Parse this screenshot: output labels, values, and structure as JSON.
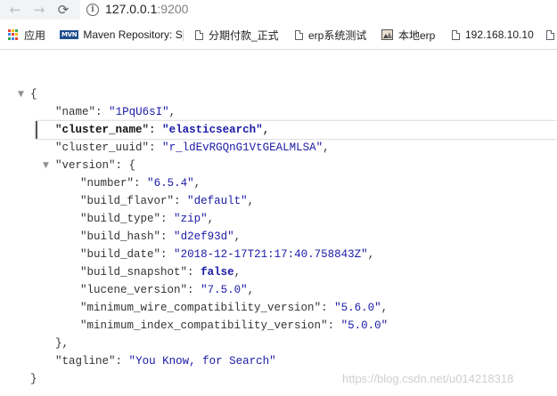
{
  "browser": {
    "back_icon": "back-arrow-icon",
    "forward_icon": "forward-arrow-icon",
    "reload_icon": "reload-icon",
    "info_icon": "info-icon",
    "url_host": "127.0.0.1",
    "url_port": ":9200"
  },
  "bookmarks": [
    {
      "label": "应用",
      "icon": "apps-grid-icon"
    },
    {
      "label": "Maven Repository: S",
      "icon": "mvn-icon"
    },
    {
      "label": "分期付款_正式",
      "icon": "page-icon"
    },
    {
      "label": "erp系统测试",
      "icon": "page-icon"
    },
    {
      "label": "本地erp",
      "icon": "image-icon"
    },
    {
      "label": "192.168.10.10",
      "icon": "page-icon"
    }
  ],
  "json": {
    "open_brace": "{",
    "close_brace": "}",
    "name": {
      "key": "name",
      "value": "1PqU6sI"
    },
    "cluster_name": {
      "key": "cluster_name",
      "value": "elasticsearch"
    },
    "cluster_uuid": {
      "key": "cluster_uuid",
      "value": "r_ldEvRGQnG1VtGEALMLSA"
    },
    "version_key": "version",
    "version": {
      "number": {
        "key": "number",
        "value": "6.5.4"
      },
      "build_flavor": {
        "key": "build_flavor",
        "value": "default"
      },
      "build_type": {
        "key": "build_type",
        "value": "zip"
      },
      "build_hash": {
        "key": "build_hash",
        "value": "d2ef93d"
      },
      "build_date": {
        "key": "build_date",
        "value": "2018-12-17T21:17:40.758843Z"
      },
      "build_snapshot": {
        "key": "build_snapshot",
        "value": "false"
      },
      "lucene_version": {
        "key": "lucene_version",
        "value": "7.5.0"
      },
      "minimum_wire_compatibility_version": {
        "key": "minimum_wire_compatibility_version",
        "value": "5.6.0"
      },
      "minimum_index_compatibility_version": {
        "key": "minimum_index_compatibility_version",
        "value": "5.0.0"
      }
    },
    "tagline": {
      "key": "tagline",
      "value": "You Know, for Search"
    }
  },
  "watermark": "https://blog.csdn.net/u014218318",
  "colors": {
    "string": "#1a1aa6",
    "key": "#333333",
    "toggle": "#909090"
  }
}
